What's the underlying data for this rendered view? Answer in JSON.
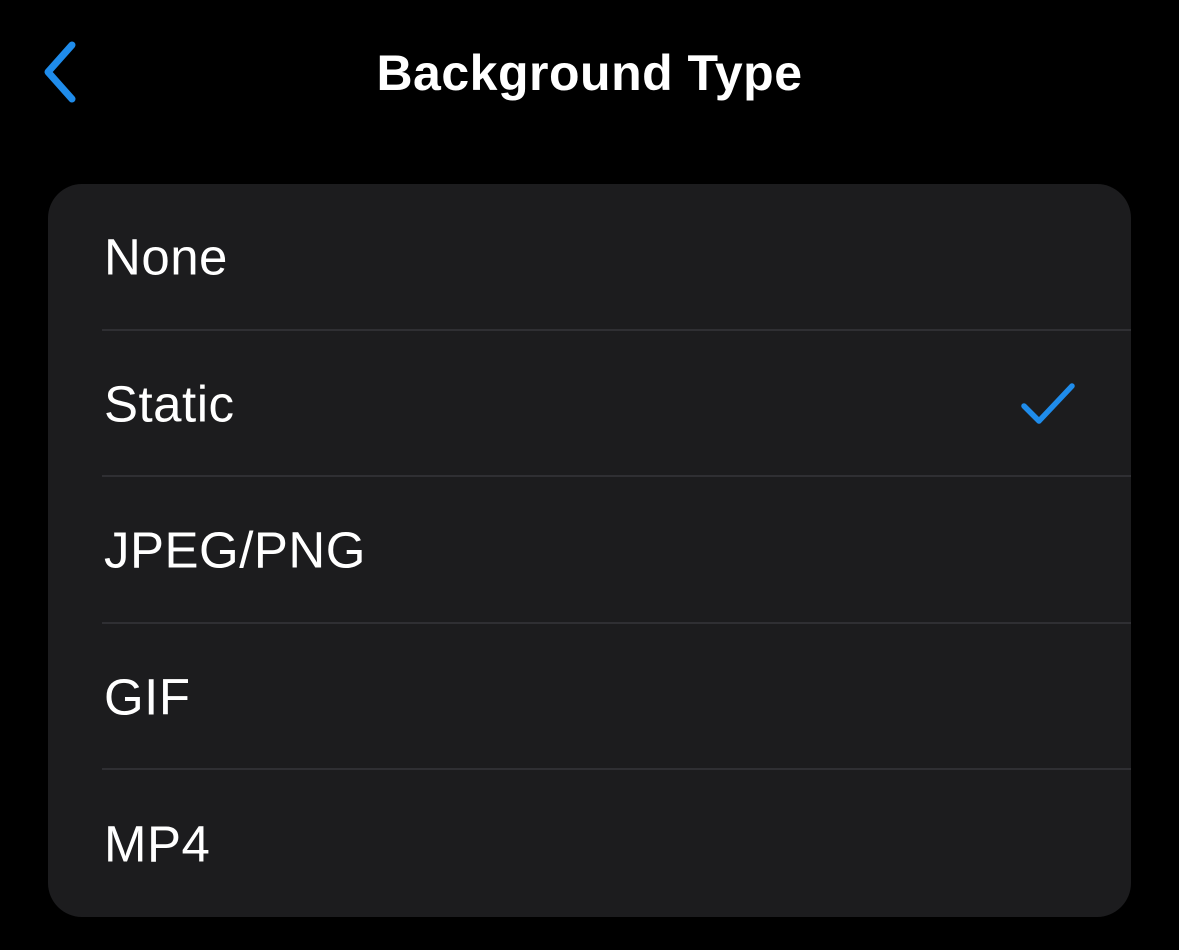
{
  "nav": {
    "title": "Background Type",
    "back_icon": "chevron-left-icon"
  },
  "colors": {
    "accent": "#1f8ceb",
    "background": "#000000",
    "card": "#1c1c1e",
    "divider": "#2f2f33",
    "text": "#ffffff"
  },
  "options": [
    {
      "label": "None",
      "selected": false
    },
    {
      "label": "Static",
      "selected": true
    },
    {
      "label": "JPEG/PNG",
      "selected": false
    },
    {
      "label": "GIF",
      "selected": false
    },
    {
      "label": "MP4",
      "selected": false
    }
  ],
  "selected_icon": "checkmark-icon"
}
